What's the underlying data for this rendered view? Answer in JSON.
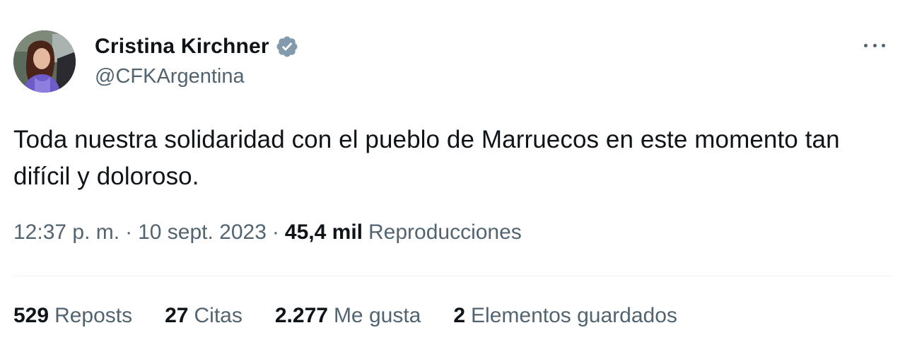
{
  "author": {
    "display_name": "Cristina Kirchner",
    "handle": "@CFKArgentina",
    "verified_color": "#829aab"
  },
  "tweet": {
    "text": "Toda nuestra solidaridad con el pueblo de Marruecos en este momento tan difícil y doloroso."
  },
  "meta": {
    "time": "12:37 p. m.",
    "separator": "·",
    "date": "10 sept. 2023",
    "views_count": "45,4 mil",
    "views_label": "Reproducciones"
  },
  "stats": {
    "reposts_count": "529",
    "reposts_label": "Reposts",
    "quotes_count": "27",
    "quotes_label": "Citas",
    "likes_count": "2.277",
    "likes_label": "Me gusta",
    "bookmarks_count": "2",
    "bookmarks_label": "Elementos guardados"
  },
  "icons": {
    "verified": "verified-badge-icon",
    "more": "more-options-icon"
  },
  "colors": {
    "text_primary": "#0f1419",
    "text_secondary": "#536471",
    "divider": "#eff3f4"
  }
}
